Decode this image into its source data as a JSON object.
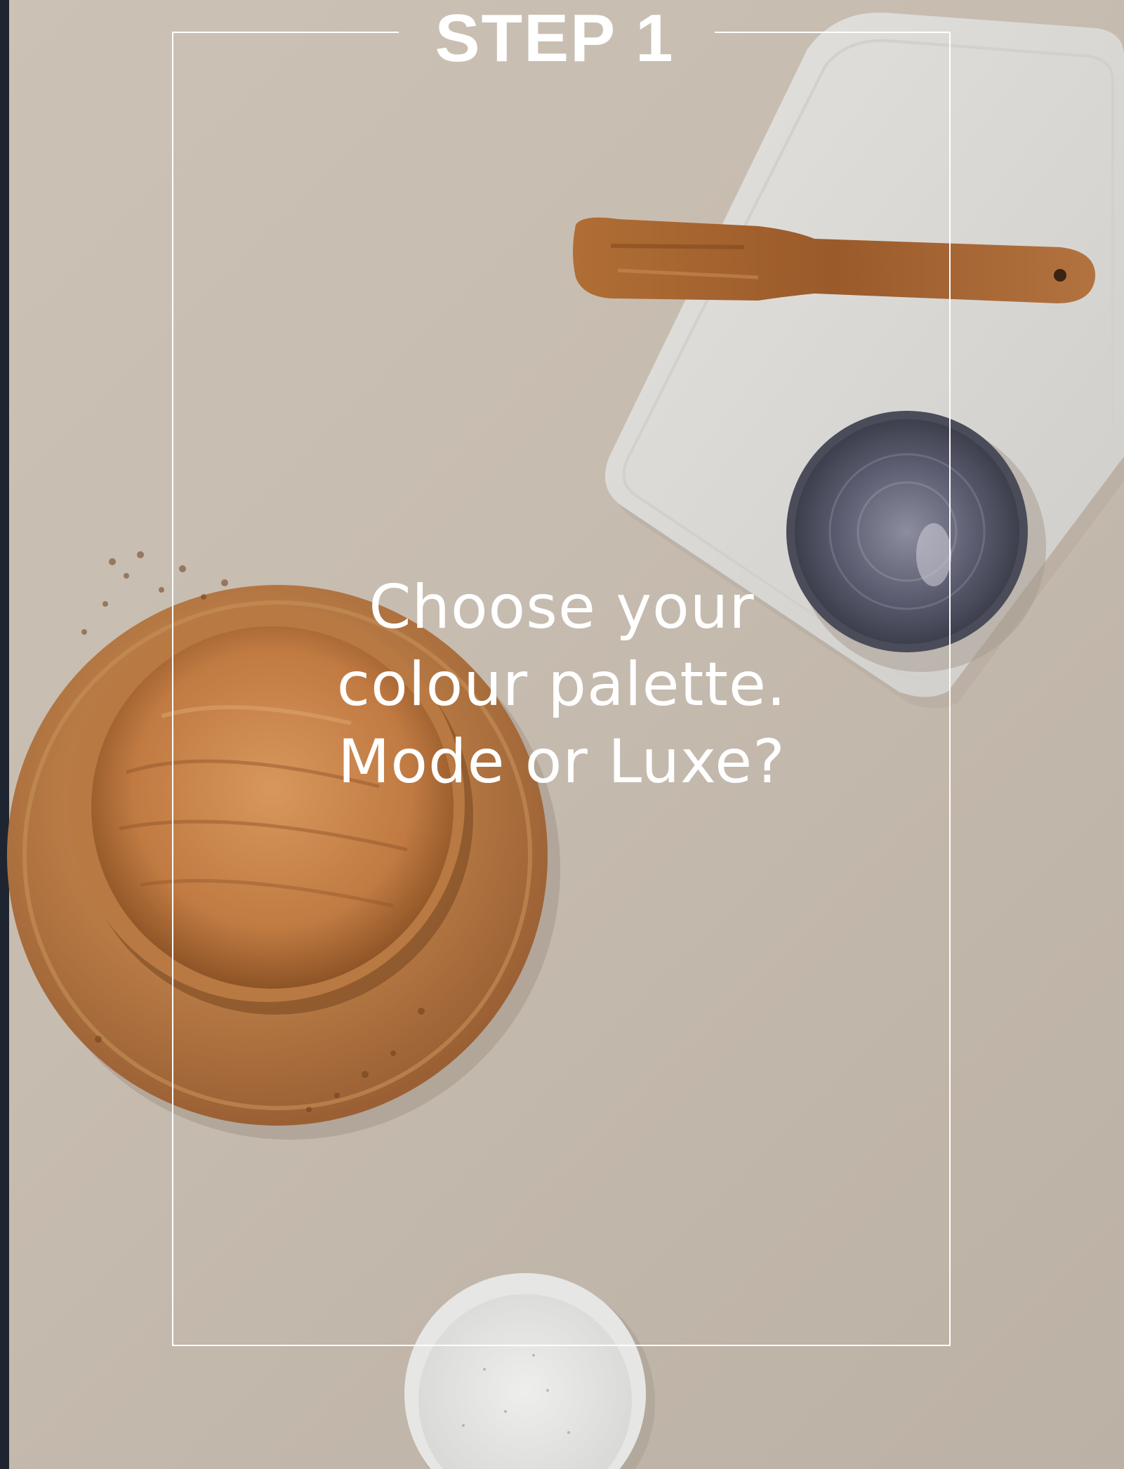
{
  "step_label": "STEP 1",
  "headline": {
    "line1": "Choose your",
    "line2": "colour palette.",
    "line3": "Mode or Luxe?"
  },
  "colors": {
    "background": "#c7bcb0",
    "text": "#ffffff",
    "left_strip": "#1f2530"
  }
}
